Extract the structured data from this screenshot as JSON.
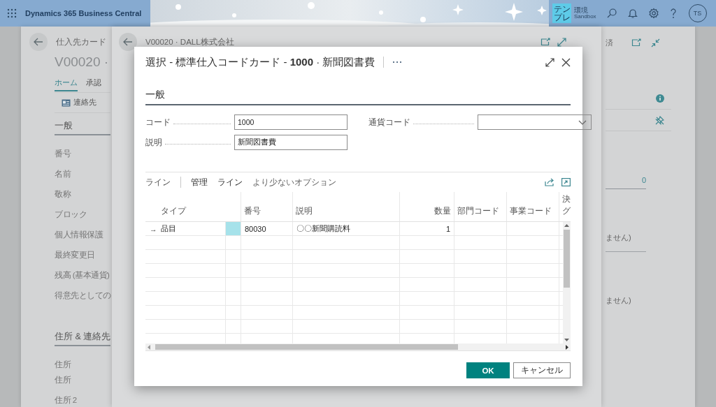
{
  "top_bar": {
    "app_title": "Dynamics 365 Business Central",
    "environment": {
      "badge": "テンプレ",
      "label": "環境",
      "name": "Sandbox"
    },
    "avatar": "TS"
  },
  "vendor_card": {
    "breadcrumb": "仕入先カード",
    "title": "V00020 ·",
    "tabs": [
      {
        "label": "ホーム",
        "selected": true
      },
      {
        "label": "承認",
        "selected": false
      }
    ],
    "actions": [
      "連絡先"
    ],
    "section": "一般",
    "fields": [
      "番号",
      "名前",
      "敬称",
      "ブロック",
      "個人情報保護",
      "最終変更日",
      "残高 (基本通貨)",
      "得意先としての"
    ],
    "section_2": "住所 & 連絡先",
    "address_heading": "住所",
    "fields_2": [
      "住所",
      "住所 2"
    ],
    "side": {
      "status": "済",
      "value": "0",
      "notes": [
        "ません)",
        "ません)"
      ]
    }
  },
  "vendor_page": {
    "title": "V00020 · DALL株式会社"
  },
  "dialog": {
    "title": "選択 - 標準仕入コードカード - **1000** · 新聞図書費",
    "section": "一般",
    "fields": [
      {
        "label": "コード",
        "value": "1000",
        "kind": "text"
      },
      {
        "label": "説明",
        "value": "新聞図書費",
        "kind": "text"
      },
      {
        "label": "通貨コード",
        "kind": "dropdown"
      }
    ],
    "lines": {
      "title": "ライン",
      "actions": [
        "管理",
        "ライン",
        "より少ないオプション"
      ],
      "columns": [
        {
          "label": "タイプ",
          "kind": "text"
        },
        {
          "label": "番号",
          "kind": "text"
        },
        {
          "label": "説明",
          "kind": "text"
        },
        {
          "label": "数量",
          "kind": "number"
        },
        {
          "label": "部門コード",
          "kind": "text"
        },
        {
          "label": "事業コード",
          "kind": "text"
        },
        {
          "label": "決グ",
          "kind": "text"
        }
      ],
      "rows": [
        {
          "marker": "→",
          "selected": true,
          "cells": [
            "品目",
            "80030",
            "〇〇新聞購読料",
            "1"
          ]
        }
      ]
    },
    "buttons": [
      {
        "label": "OK",
        "kind": "primary"
      },
      {
        "label": "キャンセル",
        "kind": "default"
      }
    ]
  }
}
